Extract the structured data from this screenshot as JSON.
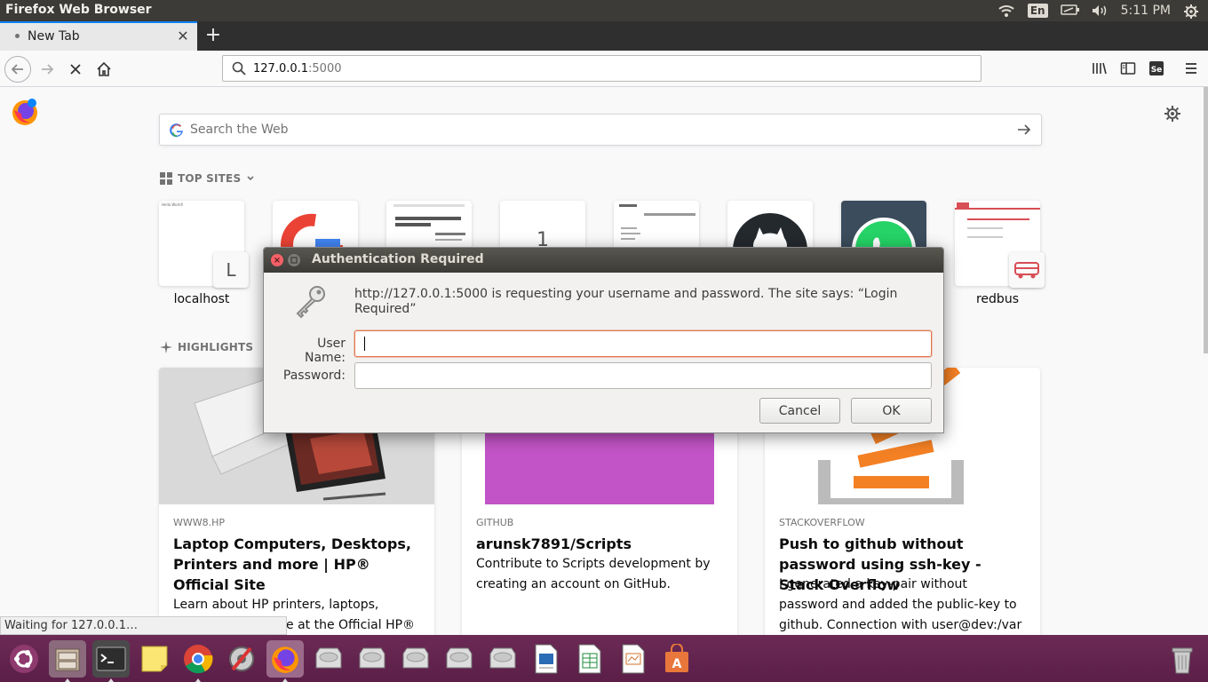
{
  "system": {
    "app_title": "Firefox Web Browser",
    "language": "En",
    "clock": "5:11 PM"
  },
  "browser": {
    "tab": {
      "title": "New Tab"
    },
    "url": {
      "host": "127.0.0.1",
      "port": ":5000"
    }
  },
  "newtab": {
    "search_placeholder": "Search the Web",
    "top_sites_title": "TOP SITES",
    "highlights_title": "HIGHLIGHTS",
    "top_sites": [
      {
        "label": "localhost",
        "badge": "L"
      },
      {
        "label": ""
      },
      {
        "label": ""
      },
      {
        "label": "",
        "preview_text": "1"
      },
      {
        "label": ""
      },
      {
        "label": ""
      },
      {
        "label": ""
      },
      {
        "label": "redbus"
      }
    ],
    "highlights": [
      {
        "source": "WWW8.HP",
        "title": "Laptop Computers, Desktops, Printers and more | HP® Official Site",
        "desc_line1": "Learn about HP printers, laptops,",
        "desc_line2": "e at the Official HP®"
      },
      {
        "source": "GITHUB",
        "title": "arunsk7891/Scripts",
        "desc": "Contribute to Scripts development by creating an account on GitHub."
      },
      {
        "source": "STACKOVERFLOW",
        "title": "Push to github without password using ssh-key - Stack Overflow",
        "desc": "I generated a key-pair without password and added the public-key to github. Connection with user@dev:/var"
      }
    ],
    "status_text": "Waiting for 127.0.0.1…"
  },
  "dialog": {
    "title": "Authentication Required",
    "message": "http://127.0.0.1:5000 is requesting your username and password. The site says: “Login Required”",
    "username_label": "User Name:",
    "password_label": "Password:",
    "username_value": "",
    "password_value": "",
    "cancel_label": "Cancel",
    "ok_label": "OK"
  },
  "colors": {
    "accent_focus": "#e2744a",
    "dock": "#5b1f48",
    "panel": "#3c3b37"
  }
}
